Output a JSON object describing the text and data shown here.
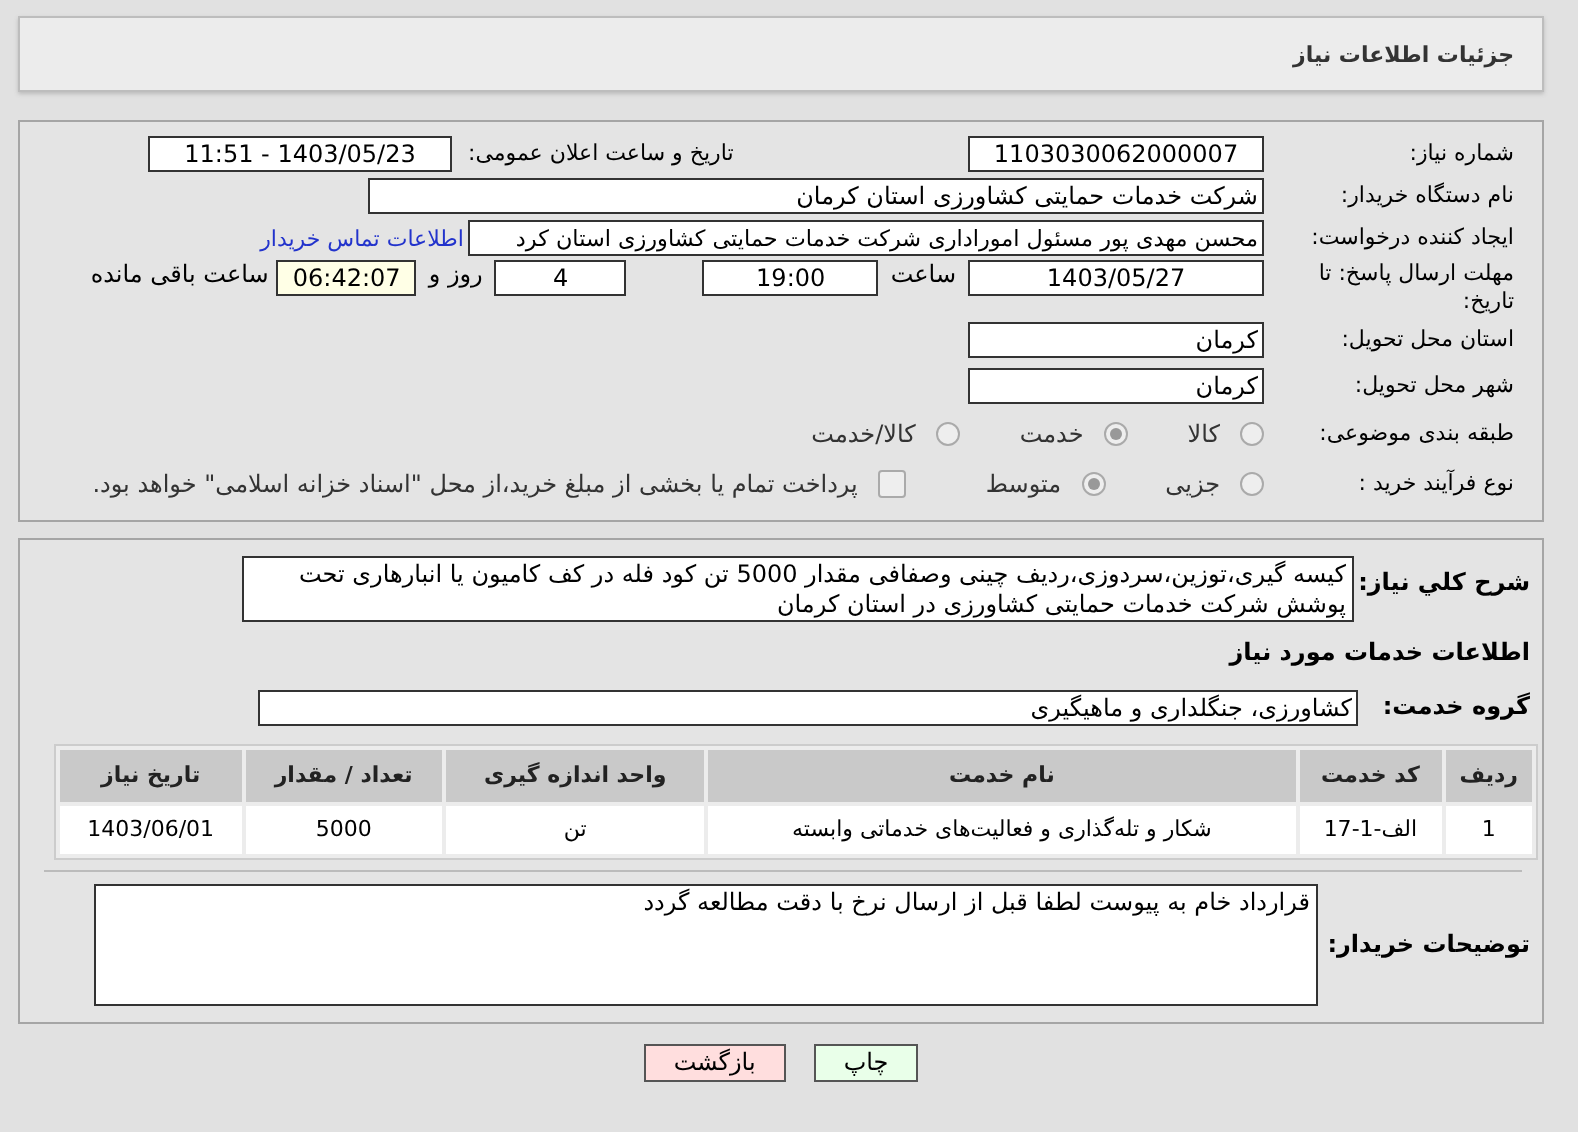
{
  "header": {
    "title": "جزئیات اطلاعات نیاز"
  },
  "need_number": {
    "label": "شماره نیاز:",
    "value": "1103030062000007"
  },
  "announce": {
    "label": "تاریخ و ساعت اعلان عمومی:",
    "value": "1403/05/23 - 11:51"
  },
  "buyer_org": {
    "label": "نام دستگاه خریدار:",
    "value": "شرکت خدمات حمایتی کشاورزی استان کرمان"
  },
  "requester": {
    "label": "ایجاد کننده درخواست:",
    "value": "محسن مهدی پور مسئول اموراداری شرکت خدمات حمایتی کشاورزی استان کرد",
    "link": "اطلاعات تماس خریدار"
  },
  "deadline": {
    "label": "مهلت ارسال پاسخ: تا تاریخ:",
    "date": "1403/05/27",
    "time_label": "ساعت",
    "time": "19:00",
    "days": "4",
    "days_label": "روز و",
    "remaining": "06:42:07",
    "remaining_label": "ساعت باقی مانده"
  },
  "province": {
    "label": "استان محل تحویل:",
    "value": "کرمان"
  },
  "city": {
    "label": "شهر محل تحویل:",
    "value": "کرمان"
  },
  "category": {
    "label": "طبقه بندی موضوعی:",
    "options": [
      {
        "label": "کالا",
        "selected": false
      },
      {
        "label": "خدمت",
        "selected": true
      },
      {
        "label": "کالا/خدمت",
        "selected": false
      }
    ]
  },
  "process": {
    "label": "نوع فرآیند خرید :",
    "options": [
      {
        "label": "جزیی",
        "selected": false
      },
      {
        "label": "متوسط",
        "selected": true
      }
    ],
    "payment": {
      "checked": false,
      "label": "پرداخت تمام یا بخشی از مبلغ خرید،از محل \"اسناد خزانه اسلامی\" خواهد بود."
    }
  },
  "description": {
    "label": "شرح کلي نياز:",
    "value": "کیسه گیری،توزین،سردوزی،ردیف چینی وصفافی مقدار 5000 تن کود فله در کف کامیون یا انبارهاری تحت پوشش شرکت خدمات حمایتی کشاورزی در استان کرمان"
  },
  "services_title": "اطلاعات خدمات مورد نیاز",
  "service_group": {
    "label": "گروه خدمت:",
    "value": "کشاورزی، جنگلداری و ماهیگیری"
  },
  "table": {
    "columns": [
      "ردیف",
      "کد خدمت",
      "نام خدمت",
      "واحد اندازه گیری",
      "تعداد / مقدار",
      "تاریخ نیاز"
    ],
    "rows": [
      [
        "1",
        "الف-1-17",
        "شکار و تله‌گذاری و فعالیت‌های خدماتی وابسته",
        "تن",
        "5000",
        "1403/06/01"
      ]
    ]
  },
  "buyer_notes": {
    "label": "توضیحات خریدار:",
    "value": "قرارداد خام به پیوست لطفا قبل از ارسال نرخ با دقت مطالعه گردد"
  },
  "buttons": [
    {
      "label": "چاپ",
      "kind": "print"
    },
    {
      "label": "بازگشت",
      "kind": "back"
    }
  ]
}
